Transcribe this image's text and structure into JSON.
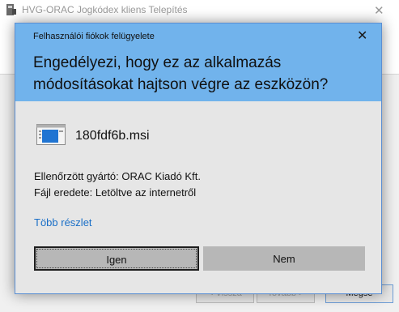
{
  "installer": {
    "title": "HVG-ORAC Jogkódex kliens Telepítés",
    "close_symbol": "✕",
    "back_label": "< Vissza",
    "next_label": "Tovább >",
    "install_label": "Mégse"
  },
  "uac": {
    "caption": "Felhasználói fiókok felügyelete",
    "close_symbol": "✕",
    "question_line1": "Engedélyezi, hogy ez az alkalmazás",
    "question_line2": "módosításokat hajtson végre az eszközön?",
    "file_icon": "installer-file-icon",
    "file_name": "180fdf6b.msi",
    "publisher": "Ellenőrzött gyártó: ORAC Kiadó Kft.",
    "origin": "Fájl eredete: Letöltve az internetről",
    "more_details": "Több részlet",
    "yes_label": "Igen",
    "no_label": "Nem"
  },
  "colors": {
    "header_blue": "#71b3ec",
    "dialog_bg": "#e6e6e6",
    "link_blue": "#1a6fc7",
    "button_gray": "#b7b7b7"
  }
}
